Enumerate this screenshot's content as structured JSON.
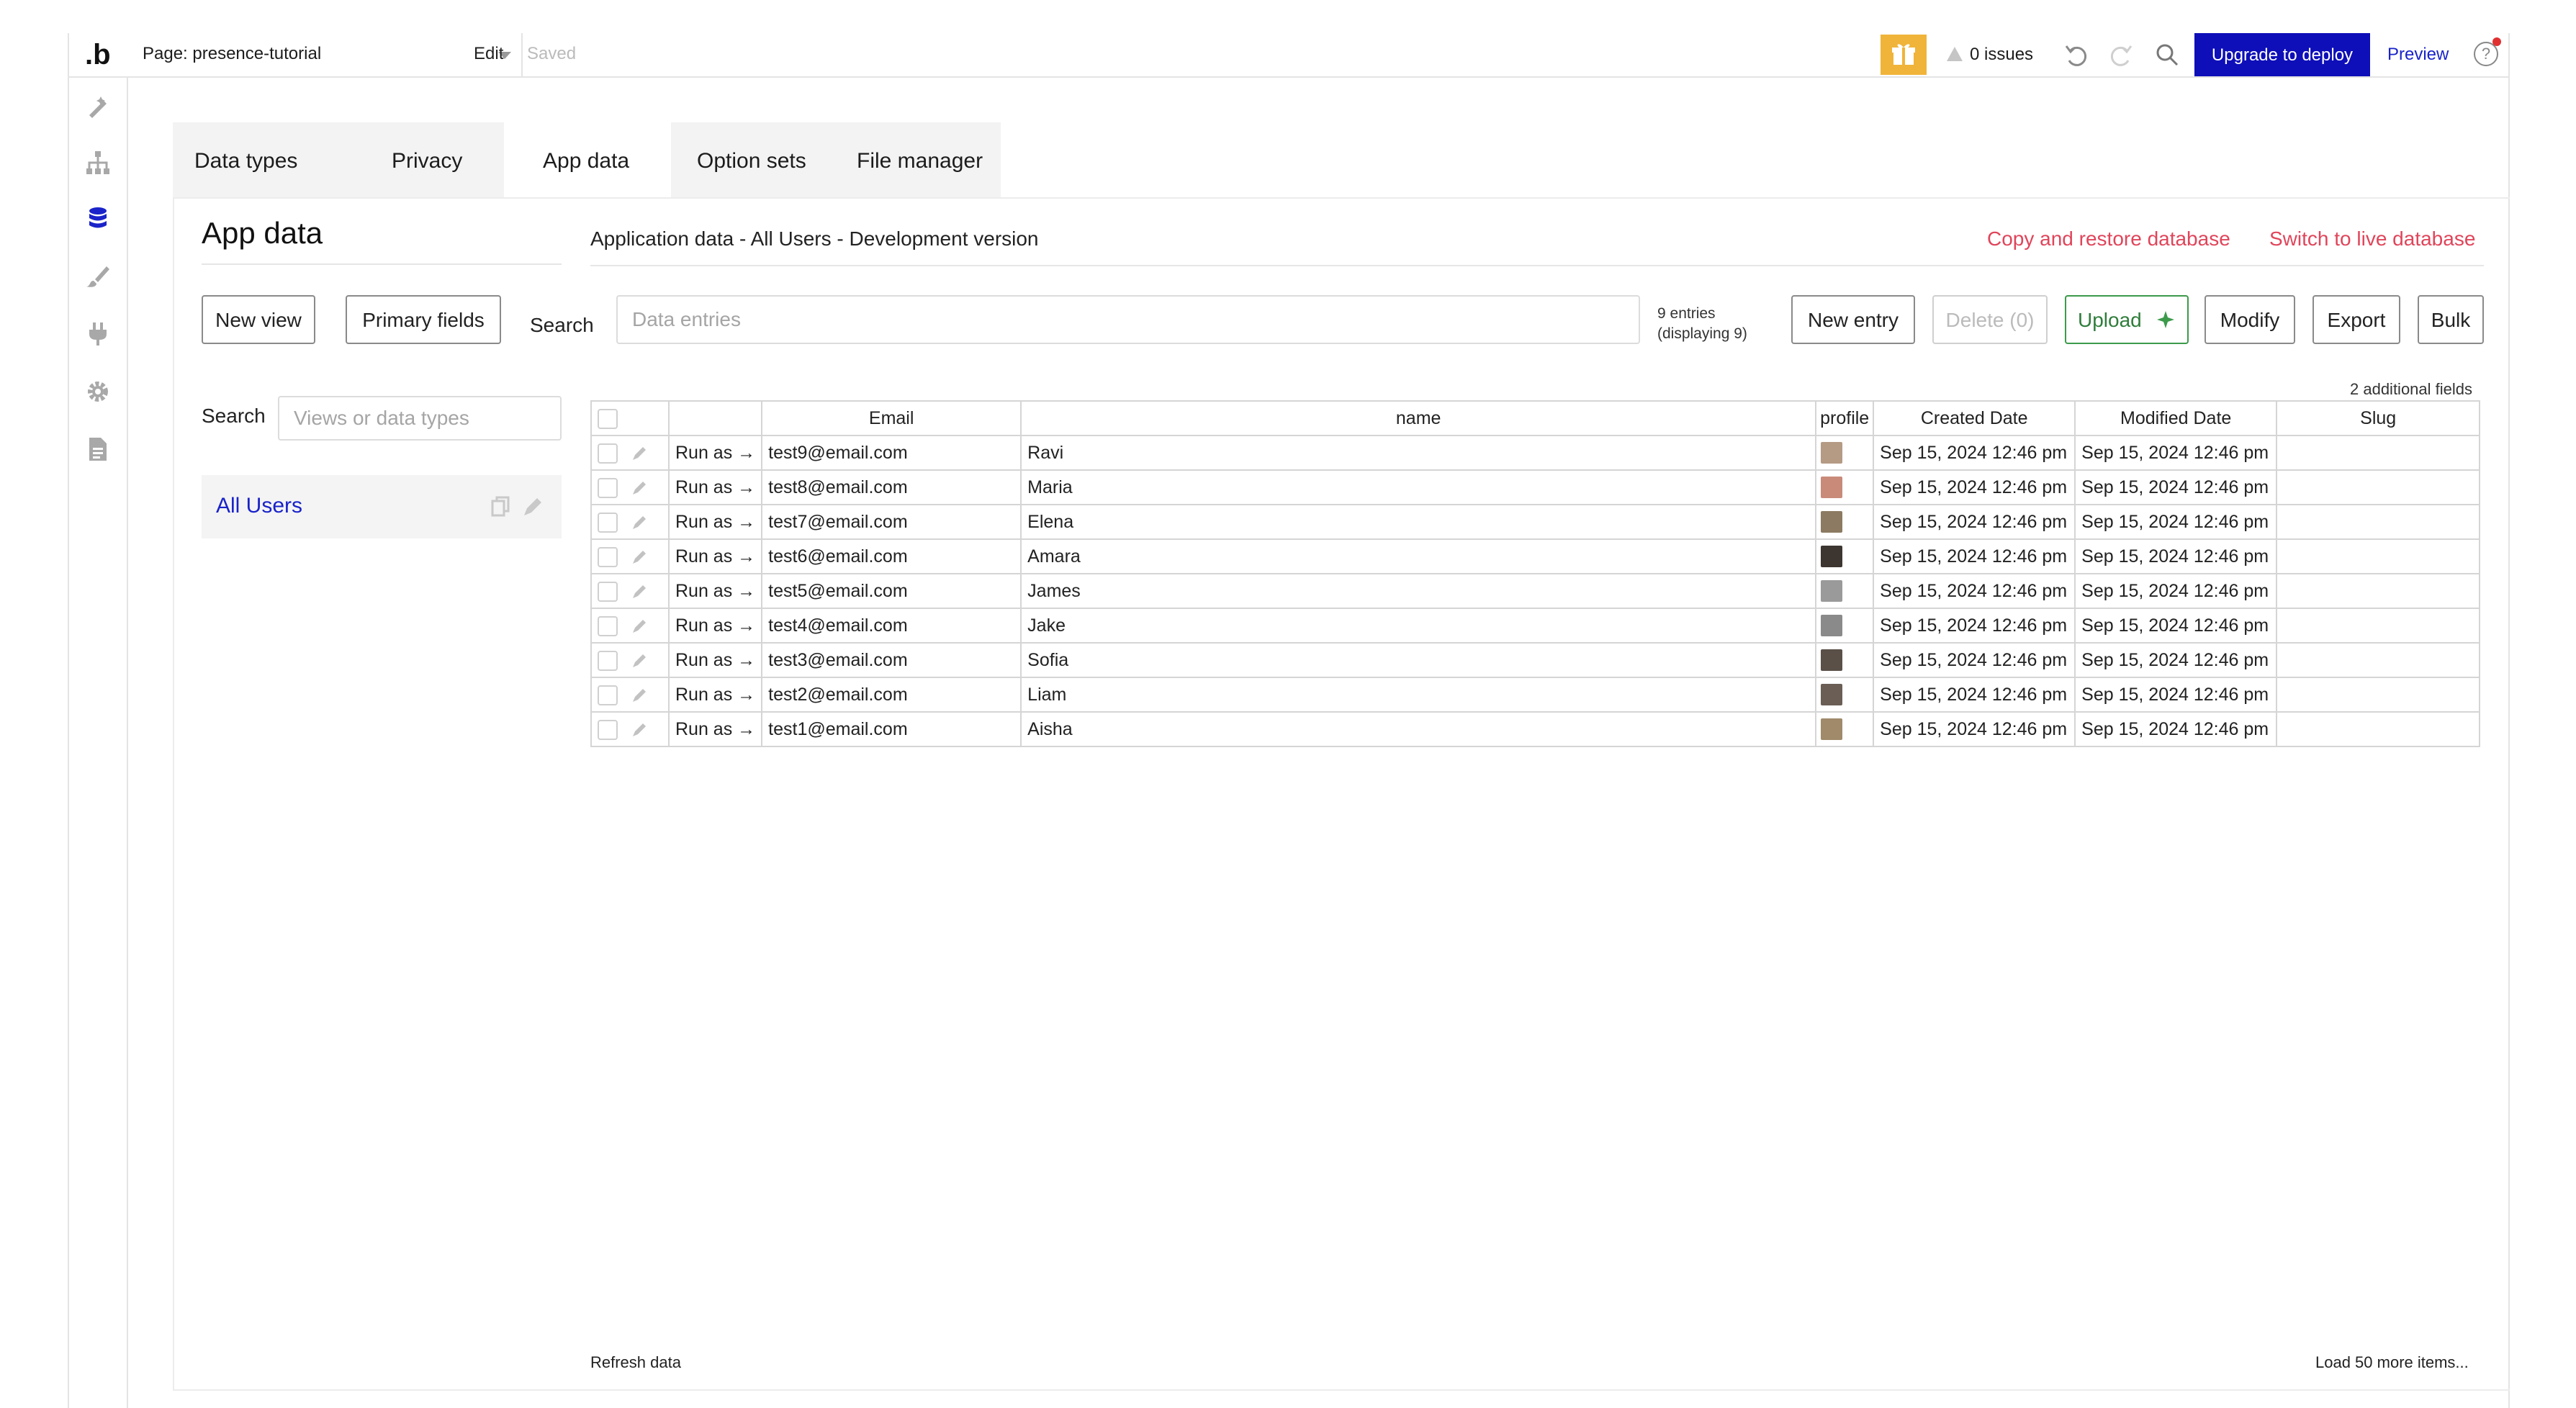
{
  "topbar": {
    "logo": ".b",
    "page_label": "Page: presence-tutorial",
    "edit": "Edit",
    "saved": "Saved",
    "issues": "0 issues",
    "upgrade": "Upgrade to deploy",
    "preview": "Preview",
    "help": "?"
  },
  "rail": [
    "design-icon",
    "workflow-icon",
    "data-icon",
    "styles-icon",
    "plugins-icon",
    "settings-icon",
    "logs-icon"
  ],
  "tabs": [
    "Data types",
    "Privacy",
    "App data",
    "Option sets",
    "File manager"
  ],
  "active_tab": "App data",
  "left": {
    "title": "App data",
    "new_view": "New view",
    "primary_fields": "Primary fields",
    "search_label": "Search",
    "search_placeholder": "Views or data types",
    "views": [
      "All Users"
    ]
  },
  "main": {
    "subtitle": "Application data - All Users - Development version",
    "copy_restore": "Copy and restore database",
    "switch_live": "Switch to live database",
    "search_label": "Search",
    "search_placeholder": "Data entries",
    "entries_line1": "9 entries",
    "entries_line2": "(displaying 9)",
    "buttons": {
      "new_entry": "New entry",
      "delete": "Delete (0)",
      "upload": "Upload",
      "modify": "Modify",
      "export": "Export",
      "bulk": "Bulk"
    },
    "additional_fields": "2 additional fields",
    "columns": [
      "Email",
      "name",
      "profile",
      "Created Date",
      "Modified Date",
      "Slug"
    ],
    "run_as": "Run as →",
    "rows": [
      {
        "email": "test9@email.com",
        "name": "Ravi",
        "created": "Sep 15, 2024 12:46 pm",
        "modified": "Sep 15, 2024 12:46 pm",
        "slug": ""
      },
      {
        "email": "test8@email.com",
        "name": "Maria",
        "created": "Sep 15, 2024 12:46 pm",
        "modified": "Sep 15, 2024 12:46 pm",
        "slug": ""
      },
      {
        "email": "test7@email.com",
        "name": "Elena",
        "created": "Sep 15, 2024 12:46 pm",
        "modified": "Sep 15, 2024 12:46 pm",
        "slug": ""
      },
      {
        "email": "test6@email.com",
        "name": "Amara",
        "created": "Sep 15, 2024 12:46 pm",
        "modified": "Sep 15, 2024 12:46 pm",
        "slug": ""
      },
      {
        "email": "test5@email.com",
        "name": "James",
        "created": "Sep 15, 2024 12:46 pm",
        "modified": "Sep 15, 2024 12:46 pm",
        "slug": ""
      },
      {
        "email": "test4@email.com",
        "name": "Jake",
        "created": "Sep 15, 2024 12:46 pm",
        "modified": "Sep 15, 2024 12:46 pm",
        "slug": ""
      },
      {
        "email": "test3@email.com",
        "name": "Sofia",
        "created": "Sep 15, 2024 12:46 pm",
        "modified": "Sep 15, 2024 12:46 pm",
        "slug": ""
      },
      {
        "email": "test2@email.com",
        "name": "Liam",
        "created": "Sep 15, 2024 12:46 pm",
        "modified": "Sep 15, 2024 12:46 pm",
        "slug": ""
      },
      {
        "email": "test1@email.com",
        "name": "Aisha",
        "created": "Sep 15, 2024 12:46 pm",
        "modified": "Sep 15, 2024 12:46 pm",
        "slug": ""
      }
    ],
    "refresh": "Refresh data",
    "load_more": "Load 50 more items..."
  },
  "colors": {
    "accent_blue": "#0e0fb8",
    "link_blue": "#1a23c9",
    "danger": "#e0455a",
    "upload_green": "#3c9a4b",
    "gift": "#f0b43a"
  }
}
